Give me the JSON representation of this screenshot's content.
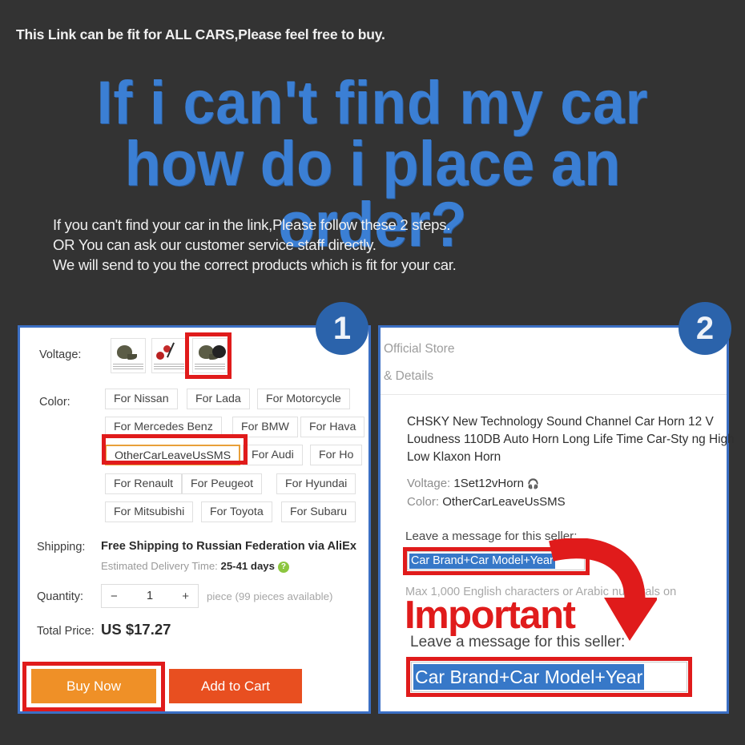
{
  "banner": {
    "text": "This Link can be fit for ALL CARS,Please feel free to buy."
  },
  "headline": {
    "line1": "If i can't find my car",
    "line2": "how do i place an order?",
    "color": "#3b7fd4"
  },
  "intro": {
    "line1": "If you can't find your car in the link,Please follow these 2 steps.",
    "line2": "OR You can ask our customer service staff directly.",
    "line3": "We will send to you the correct products which is fit for your car."
  },
  "steps": {
    "badge1": "1",
    "badge2": "2",
    "badge_color": "#2b63ab"
  },
  "left_panel": {
    "voltage_label": "Voltage:",
    "color_label": "Color:",
    "color_options": [
      "For Nissan",
      "For Lada",
      "For Motorcycle",
      "For Mercedes Benz",
      "For BMW",
      "For Hava",
      "OtherCarLeaveUsSMS",
      "For Audi",
      "For Ho",
      "For Renault",
      "For Peugeot",
      "For Hyundai",
      "For Mitsubishi",
      "For Toyota",
      "For Subaru"
    ],
    "selected_color": "OtherCarLeaveUsSMS",
    "shipping_label": "Shipping:",
    "shipping_value": "Free Shipping to Russian Federation via AliEx",
    "delivery_prefix": "Estimated Delivery Time:",
    "delivery_value": "25-41  days",
    "help_icon": "?",
    "quantity_label": "Quantity:",
    "qty_minus": "−",
    "qty_value": "1",
    "qty_plus": "+",
    "qty_note": "piece (99 pieces available)",
    "total_label": "Total Price:",
    "total_value": "US $17.27",
    "buy_now": "Buy Now",
    "add_to_cart": "Add to Cart",
    "buy_now_color": "#ef9027",
    "add_to_cart_color": "#e84f20"
  },
  "right_panel": {
    "store": "Official Store",
    "tabs": "& Details",
    "product_title": "CHSKY New Technology Sound Channel Car Horn 12 V Loudness 110DB Auto Horn Long Life Time Car-Sty ng High Low Klaxon Horn",
    "voltage_key": "Voltage:",
    "voltage_value": "1Set12vHorn",
    "color_key": "Color:",
    "color_value": "OtherCarLeaveUsSMS",
    "message_label_top": "Leave a message for this seller:",
    "message_value_top": "Car Brand+Car Model+Year",
    "hint": "Max 1,000 English characters or Arabic numerals on",
    "message_label_bottom": "Leave a message for this seller:",
    "message_value_bottom": "Car Brand+Car Model+Year",
    "important": "Important",
    "important_color": "#e01b1b"
  }
}
